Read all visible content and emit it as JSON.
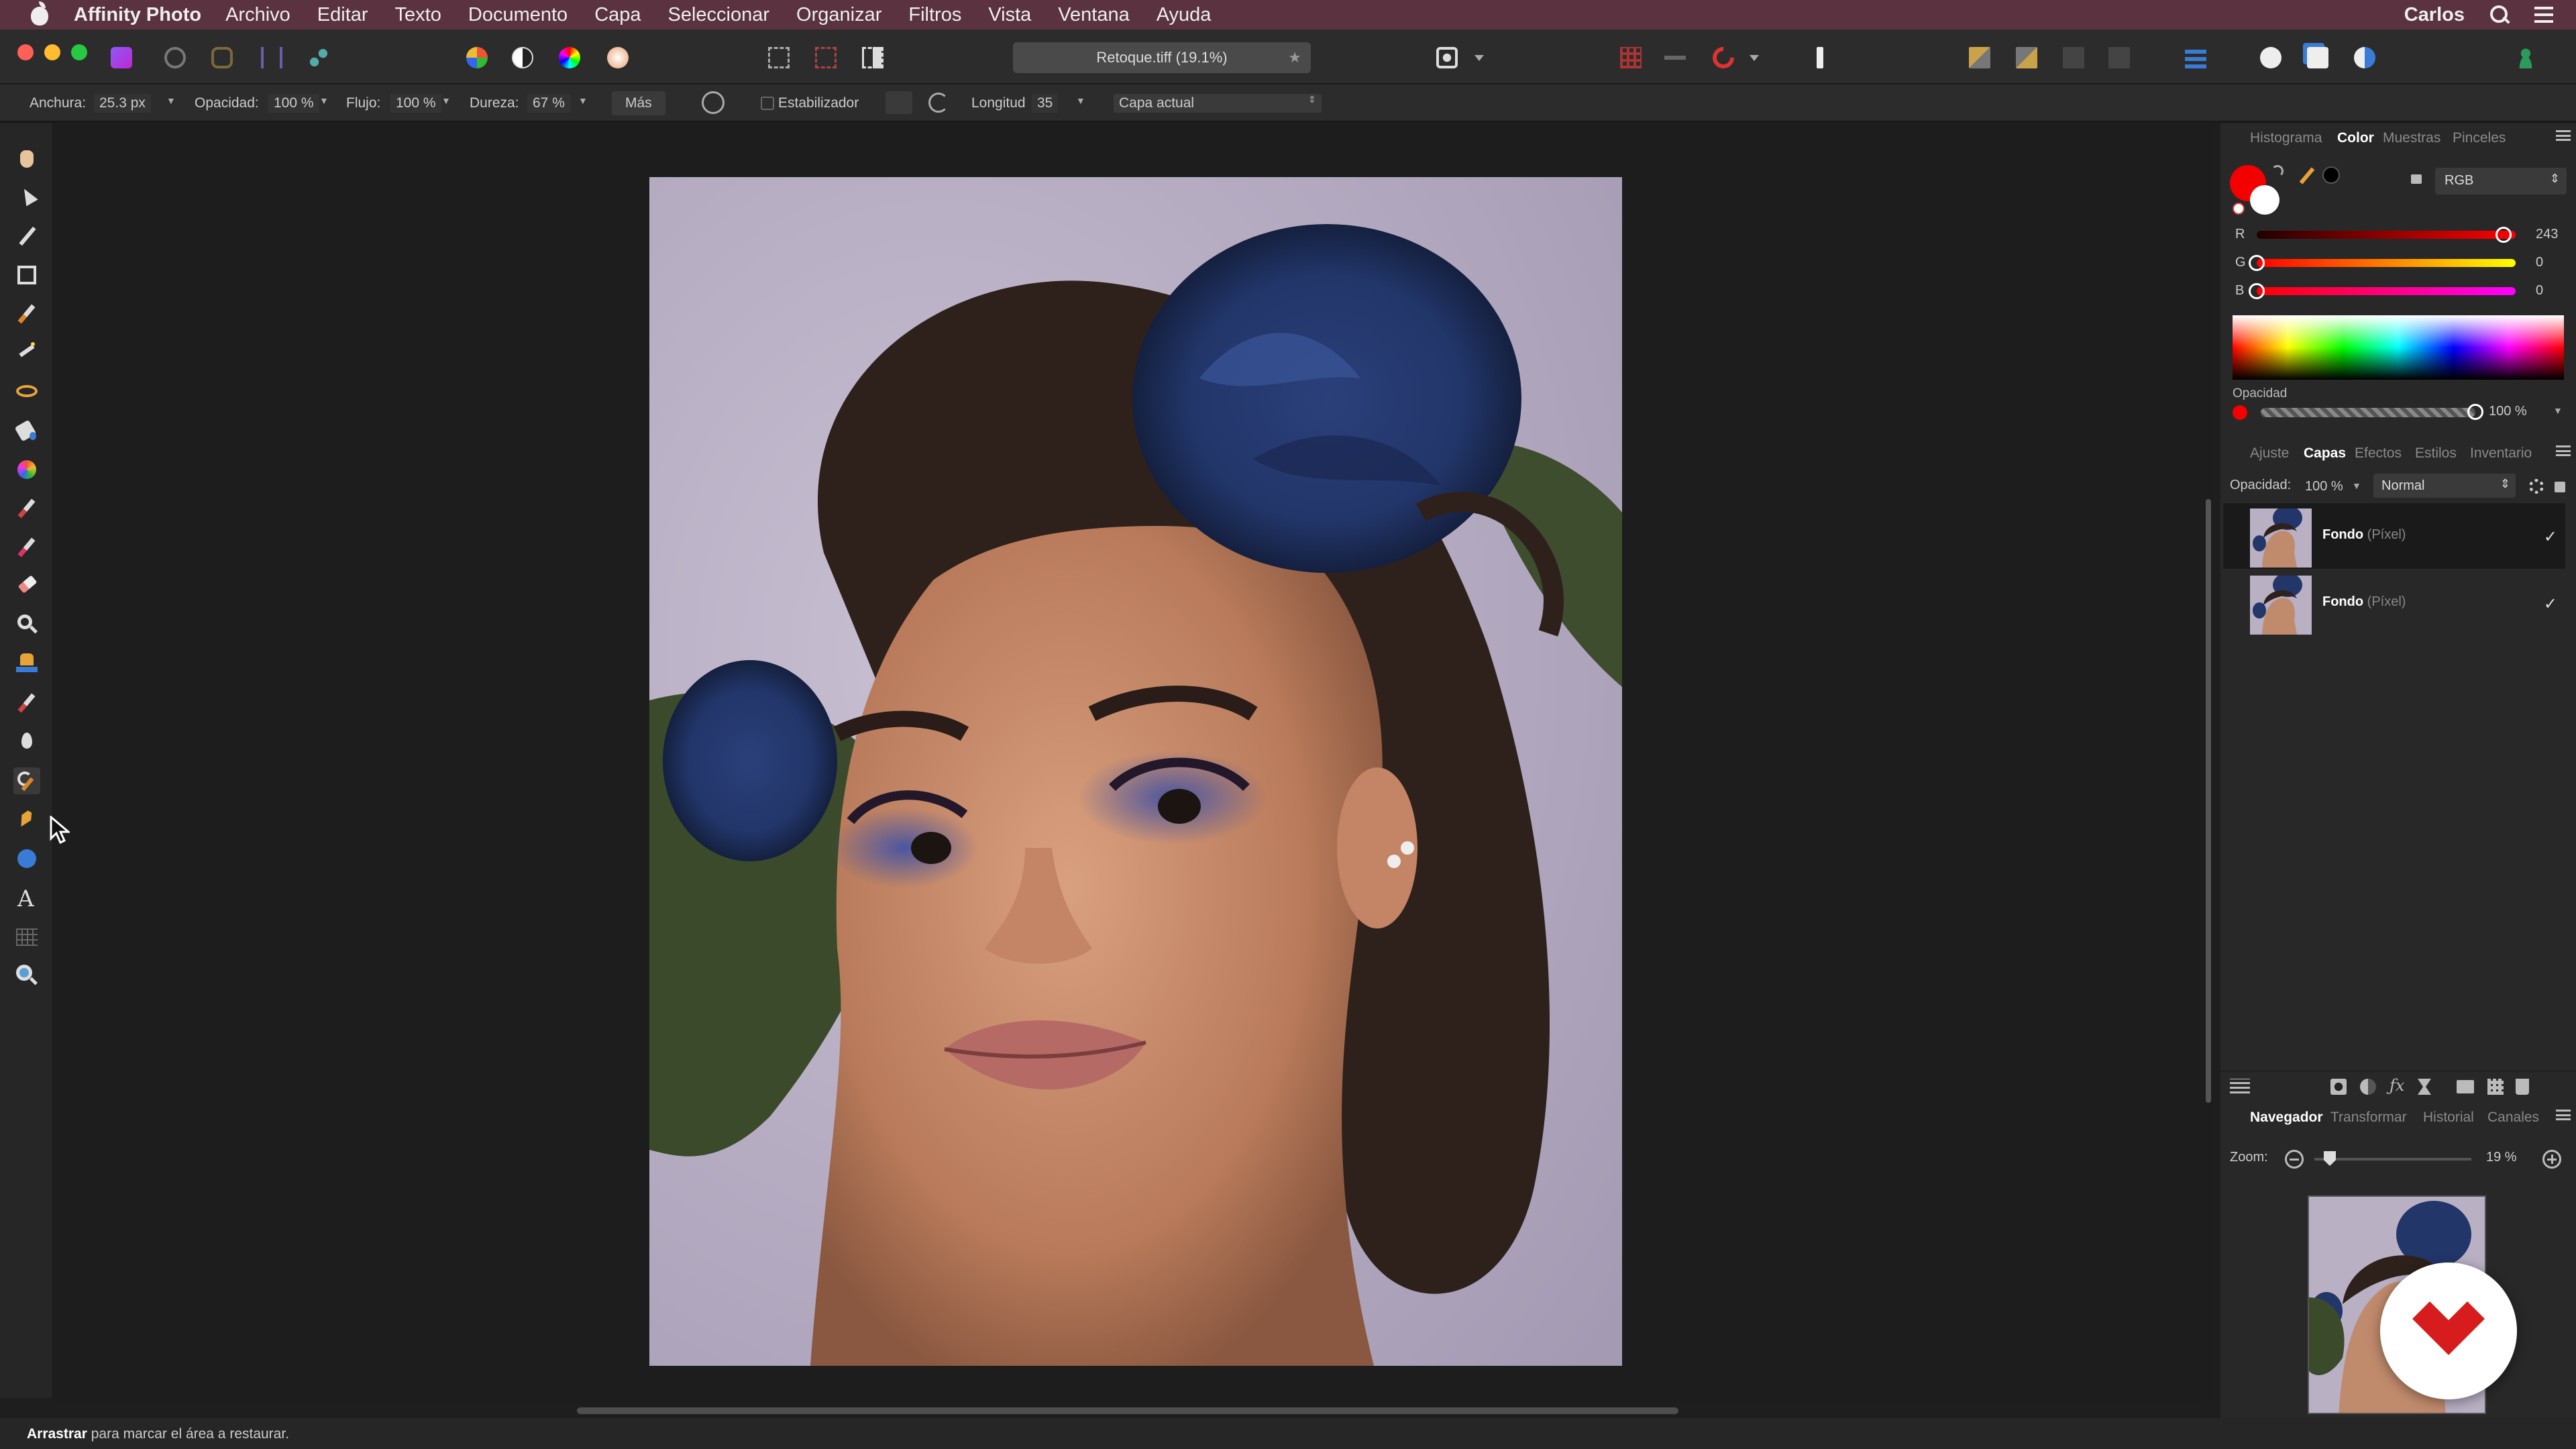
{
  "menubar": {
    "app": "Affinity Photo",
    "items": [
      "Archivo",
      "Editar",
      "Texto",
      "Documento",
      "Capa",
      "Seleccionar",
      "Organizar",
      "Filtros",
      "Vista",
      "Ventana",
      "Ayuda"
    ],
    "user": "Carlos"
  },
  "document": {
    "tab_title": "Retoque.tiff (19.1%)"
  },
  "context": {
    "width_label": "Anchura:",
    "width_value": "25.3 px",
    "opacity_label": "Opacidad:",
    "opacity_value": "100 %",
    "flow_label": "Flujo:",
    "flow_value": "100 %",
    "hardness_label": "Dureza:",
    "hardness_value": "67 %",
    "more_label": "Más",
    "stabilizer_label": "Estabilizador",
    "length_label": "Longitud",
    "length_value": "35",
    "source_value": "Capa actual"
  },
  "color_panel": {
    "tabs": [
      "Histograma",
      "Color",
      "Muestras",
      "Pinceles"
    ],
    "active_tab": "Color",
    "model": "RGB",
    "r_label": "R",
    "r_value": "243",
    "g_label": "G",
    "g_value": "0",
    "b_label": "B",
    "b_value": "0",
    "r_fraction": 0.953,
    "g_fraction": 0,
    "b_fraction": 0,
    "opacity_label": "Opacidad",
    "opacity_value": "100 %",
    "primary_color": "#f30000"
  },
  "layers_panel": {
    "tabs": [
      "Ajuste",
      "Capas",
      "Efectos",
      "Estilos",
      "Inventario"
    ],
    "active_tab": "Capas",
    "opacity_label": "Opacidad:",
    "opacity_value": "100 %",
    "blend_mode": "Normal",
    "layers": [
      {
        "name": "Fondo",
        "type": "(Píxel)",
        "selected": true
      },
      {
        "name": "Fondo",
        "type": "(Píxel)",
        "selected": false
      }
    ]
  },
  "navigator_panel": {
    "tabs": [
      "Navegador",
      "Transformar",
      "Historial",
      "Canales"
    ],
    "active_tab": "Navegador",
    "zoom_label": "Zoom:",
    "zoom_value": "19 %"
  },
  "status": {
    "bold": "Arrastrar",
    "text": " para marcar el área a restaurar."
  },
  "colors": {
    "menubar": "#5a3240",
    "accent_red": "#d61c1c"
  }
}
